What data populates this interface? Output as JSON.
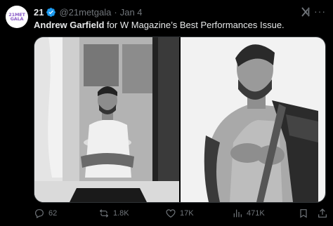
{
  "author": {
    "avatar_text_line1": "21MET",
    "avatar_text_line2": "GALA",
    "display_name": "21",
    "handle": "@21metgala",
    "separator": "·",
    "date": "Jan 4"
  },
  "tweet": {
    "bold_text": "Andrew Garfield",
    "text": " for W Magazine’s Best Performances Issue."
  },
  "actions": {
    "replies": "62",
    "reposts": "1.8K",
    "likes": "17K",
    "views": "471K"
  },
  "colors": {
    "background": "#000000",
    "text": "#e7e9ea",
    "muted": "#71767b",
    "verified": "#1d9bf0",
    "avatar_accent": "#8a5cc7"
  }
}
